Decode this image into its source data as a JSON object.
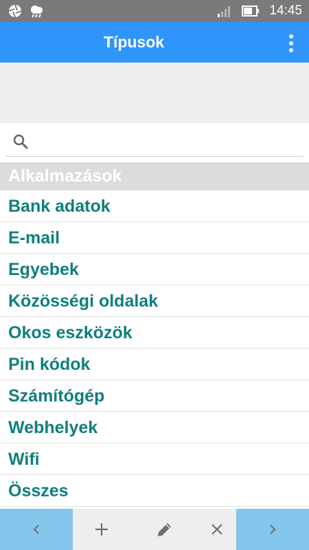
{
  "status_bar": {
    "time": "14:45",
    "icons": [
      "aperture-icon",
      "weather-icon",
      "signal-icon",
      "battery-icon"
    ]
  },
  "app_bar": {
    "title": "Típusok",
    "menu_icon": "overflow-menu-icon",
    "color": "#2f95fb"
  },
  "search": {
    "placeholder": "",
    "value": "",
    "icon": "search-icon"
  },
  "list": {
    "header": "Alkalmazások",
    "items": [
      "Bank adatok",
      "E-mail",
      "Egyebek",
      "Közösségi oldalak",
      "Okos eszközök",
      "Pin kódok",
      "Számítógép",
      "Webhelyek",
      "Wifi",
      "Összes"
    ],
    "item_color": "#0e7f7c"
  },
  "toolbar": {
    "buttons": [
      "chevron-left-icon",
      "plus-icon",
      "pencil-icon",
      "close-icon",
      "chevron-right-icon"
    ],
    "nav_color": "#84c6ec"
  }
}
